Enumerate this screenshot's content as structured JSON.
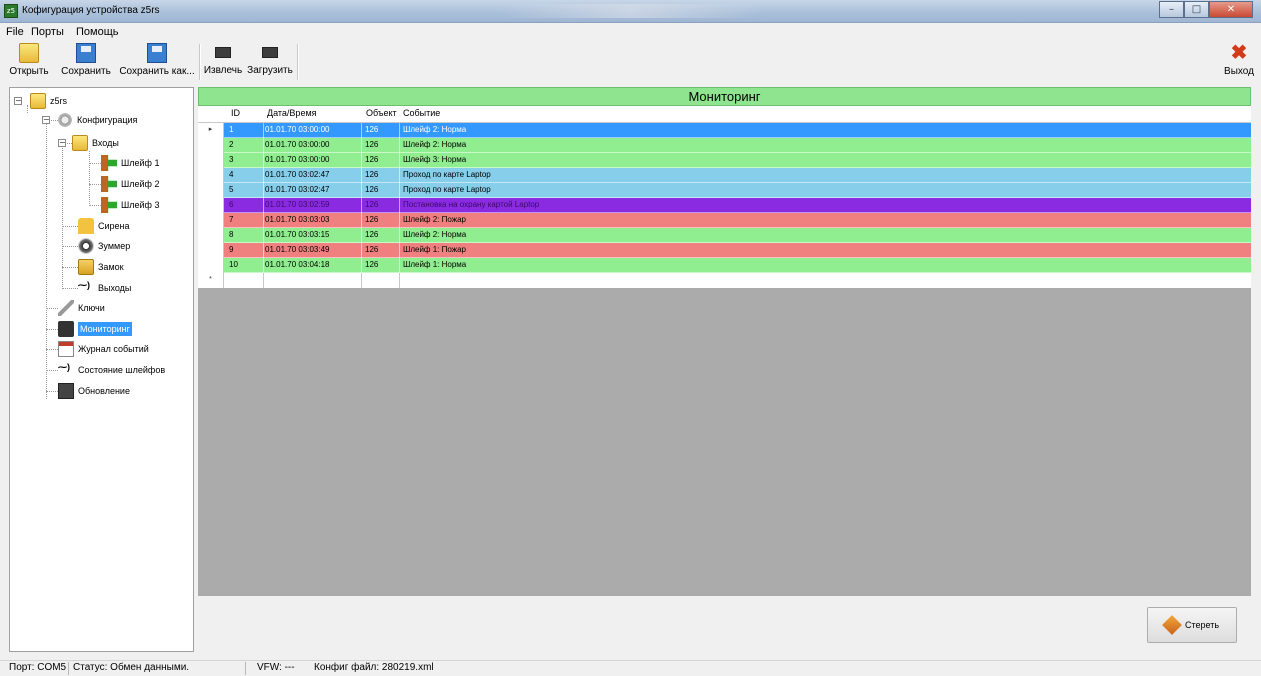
{
  "window": {
    "title": "Кофигурация устройства z5rs"
  },
  "menu": {
    "items": [
      "File",
      "Порты",
      "Помощь"
    ]
  },
  "toolbar": {
    "open": "Открыть",
    "save": "Сохранить",
    "save_as": "Сохранить как...",
    "extract": "Извлечь",
    "load": "Загрузить",
    "exit": "Выход"
  },
  "tree": {
    "root": "z5rs",
    "config": "Конфигурация",
    "inputs": "Входы",
    "loop1": "Шлейф 1",
    "loop2": "Шлейф 2",
    "loop3": "Шлейф 3",
    "siren": "Сирена",
    "buzzer": "Зуммер",
    "lock": "Замок",
    "outputs": "Выходы",
    "keys": "Ключи",
    "monitoring": "Мониторинг",
    "journal": "Журнал событий",
    "loop_state": "Состояние шлейфов",
    "update": "Обновление"
  },
  "monitor": {
    "title": "Мониторинг",
    "columns": {
      "id": "ID",
      "datetime": "Дата/Время",
      "object": "Объект",
      "event": "Событие"
    },
    "rows": [
      {
        "id": "1",
        "datetime": "01.01.70  03:00:00",
        "object": "126",
        "event": "Шлейф 2: Норма",
        "color": "#3399ff",
        "text": "#ffffff"
      },
      {
        "id": "2",
        "datetime": "01.01.70  03:00:00",
        "object": "126",
        "event": "Шлейф 2: Норма",
        "color": "#90ee90",
        "text": "#000000"
      },
      {
        "id": "3",
        "datetime": "01.01.70  03:00:00",
        "object": "126",
        "event": "Шлейф 3: Норма",
        "color": "#90ee90",
        "text": "#000000"
      },
      {
        "id": "4",
        "datetime": "01.01.70  03:02:47",
        "object": "126",
        "event": "Проход по карте Laptop",
        "color": "#87ceeb",
        "text": "#000000"
      },
      {
        "id": "5",
        "datetime": "01.01.70  03:02:47",
        "object": "126",
        "event": "Проход по карте Laptop",
        "color": "#87ceeb",
        "text": "#000000"
      },
      {
        "id": "6",
        "datetime": "01.01.70  03:02:59",
        "object": "126",
        "event": "Постановка на охрану картой Laptop",
        "color": "#8a2be2",
        "text": "#3b0a6b"
      },
      {
        "id": "7",
        "datetime": "01.01.70  03:03:03",
        "object": "126",
        "event": "Шлейф 2: Пожар",
        "color": "#f08080",
        "text": "#000000"
      },
      {
        "id": "8",
        "datetime": "01.01.70  03:03:15",
        "object": "126",
        "event": "Шлейф 2: Норма",
        "color": "#90ee90",
        "text": "#000000"
      },
      {
        "id": "9",
        "datetime": "01.01.70  03:03:49",
        "object": "126",
        "event": "Шлейф 1: Пожар",
        "color": "#f08080",
        "text": "#000000"
      },
      {
        "id": "10",
        "datetime": "01.01.70  03:04:18",
        "object": "126",
        "event": "Шлейф 1: Норма",
        "color": "#90ee90",
        "text": "#000000"
      }
    ],
    "erase_label": "Стереть"
  },
  "status": {
    "port": "Порт:  COM5",
    "state": "Статус:  Обмен данными.",
    "vfw": "VFW:  ---",
    "config_file": "Конфиг файл:  280219.xml"
  }
}
